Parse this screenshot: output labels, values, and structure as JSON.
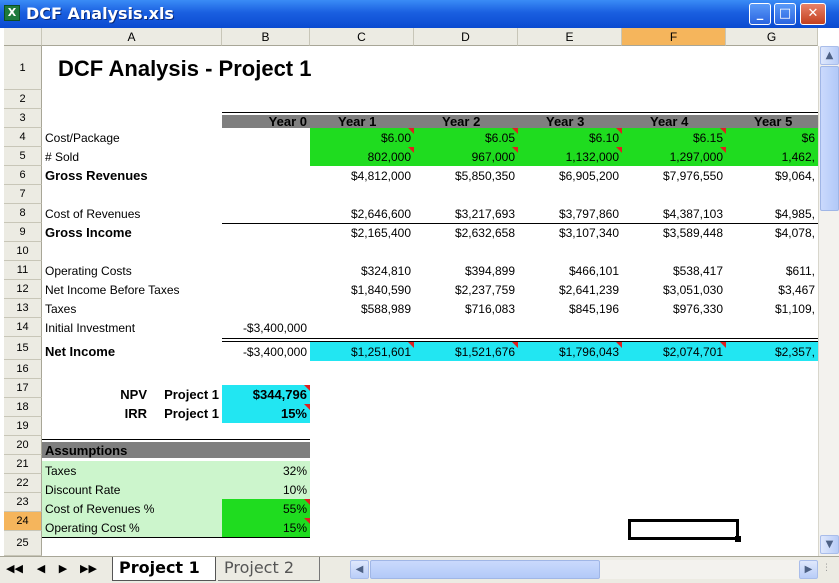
{
  "window": {
    "title": "DCF Analysis.xls",
    "app_icon": "excel-icon",
    "minimize": "_",
    "maximize": "□",
    "close": "✕"
  },
  "columns": [
    "A",
    "B",
    "C",
    "D",
    "E",
    "F",
    "G"
  ],
  "selected_column": "F",
  "rows": [
    "1",
    "2",
    "3",
    "4",
    "5",
    "6",
    "7",
    "8",
    "9",
    "10",
    "11",
    "12",
    "13",
    "14",
    "15",
    "16",
    "17",
    "18",
    "19",
    "20",
    "21",
    "22",
    "23",
    "24",
    "25"
  ],
  "selected_row": "24",
  "sheet": {
    "title": "DCF Analysis - Project 1",
    "year_headers": [
      "Year 0",
      "Year 1",
      "Year 2",
      "Year 3",
      "Year 4",
      "Year 5"
    ],
    "cost_per_package": {
      "label": "Cost/Package",
      "values": [
        "$6.00",
        "$6.05",
        "$6.10",
        "$6.15",
        "$6"
      ]
    },
    "num_sold": {
      "label": "# Sold",
      "values": [
        "802,000",
        "967,000",
        "1,132,000",
        "1,297,000",
        "1,462,"
      ]
    },
    "gross_revenues": {
      "label": "Gross Revenues",
      "values": [
        "$4,812,000",
        "$5,850,350",
        "$6,905,200",
        "$7,976,550",
        "$9,064,"
      ]
    },
    "cost_of_revenues": {
      "label": "Cost of Revenues",
      "values": [
        "$2,646,600",
        "$3,217,693",
        "$3,797,860",
        "$4,387,103",
        "$4,985,"
      ]
    },
    "gross_income": {
      "label": "Gross Income",
      "values": [
        "$2,165,400",
        "$2,632,658",
        "$3,107,340",
        "$3,589,448",
        "$4,078,"
      ]
    },
    "operating_costs": {
      "label": "Operating Costs",
      "values": [
        "$324,810",
        "$394,899",
        "$466,101",
        "$538,417",
        "$611,"
      ]
    },
    "net_income_before_taxes": {
      "label": "Net Income Before Taxes",
      "values": [
        "$1,840,590",
        "$2,237,759",
        "$2,641,239",
        "$3,051,030",
        "$3,467"
      ]
    },
    "taxes": {
      "label": "Taxes",
      "values": [
        "$588,989",
        "$716,083",
        "$845,196",
        "$976,330",
        "$1,109,"
      ]
    },
    "initial_investment": {
      "label": "Initial Investment",
      "value": "-$3,400,000"
    },
    "net_income": {
      "label": "Net Income",
      "year0": "-$3,400,000",
      "values": [
        "$1,251,601",
        "$1,521,676",
        "$1,796,043",
        "$2,074,701",
        "$2,357,"
      ]
    },
    "npv": {
      "label": "NPV",
      "project": "Project 1",
      "value": "$344,796"
    },
    "irr": {
      "label": "IRR",
      "project": "Project 1",
      "value": "15%"
    },
    "assumptions": {
      "header": "Assumptions",
      "items": [
        {
          "label": "Taxes",
          "value": "32%"
        },
        {
          "label": "Discount Rate",
          "value": "10%"
        },
        {
          "label": "Cost of Revenues %",
          "value": "55%"
        },
        {
          "label": "Operating Cost %",
          "value": "15%"
        }
      ]
    }
  },
  "tabs": {
    "active": "Project 1",
    "inactive": "Project 2"
  },
  "nav": {
    "first": "◀◀",
    "prev": "◀",
    "next": "▶",
    "last": "▶▶"
  },
  "scroll": {
    "up": "▲",
    "down": "▼",
    "left": "◀",
    "right": "▶",
    "grip": "⋮"
  }
}
